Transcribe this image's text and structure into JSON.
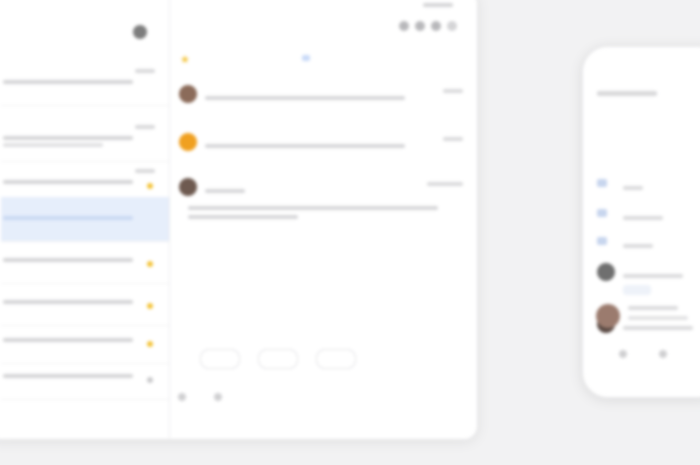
{
  "tablet": {
    "list": {
      "items": [
        {
          "sender": "",
          "star": "none",
          "selected": false
        },
        {
          "sender": "",
          "star": "none",
          "selected": false
        },
        {
          "sender": "",
          "star": "gold",
          "selected": false
        },
        {
          "sender": "",
          "star": "none",
          "selected": true
        },
        {
          "sender": "",
          "star": "gold",
          "selected": false
        },
        {
          "sender": "",
          "star": "gold",
          "selected": false
        },
        {
          "sender": "",
          "star": "gold",
          "selected": false
        },
        {
          "sender": "",
          "star": "grey",
          "selected": false
        }
      ]
    },
    "thread": {
      "subject": "",
      "messages": [
        {
          "sender": "",
          "avatar_color": "#8b6b5a"
        },
        {
          "sender": "",
          "avatar_color": "#f0a020"
        },
        {
          "sender": "",
          "avatar_color": "#6e5a50"
        }
      ],
      "reply_buttons": [
        "",
        "",
        ""
      ]
    }
  },
  "phone": {
    "folders": [
      {
        "label": ""
      },
      {
        "label": ""
      },
      {
        "label": ""
      }
    ],
    "conversations": [
      {
        "sender": "",
        "avatar_color": "#6f6f6f"
      },
      {
        "sender": "",
        "avatar_color": "#5a4a44"
      },
      {
        "sender": "",
        "avatar_color": "#9b7b6e"
      }
    ]
  },
  "colors": {
    "accent": "#4285f4",
    "selected_row": "#e6eefb",
    "star": "#f3c234"
  }
}
